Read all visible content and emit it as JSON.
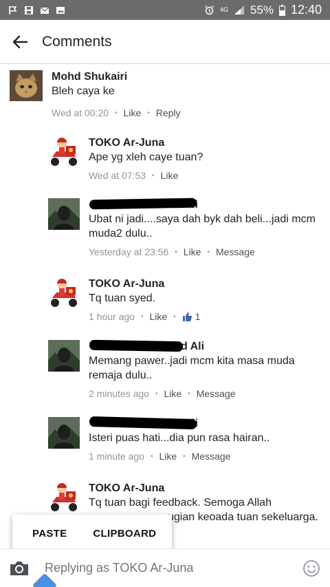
{
  "status_bar": {
    "battery": "55%",
    "time": "12:40",
    "network": "4G"
  },
  "header": {
    "title": "Comments"
  },
  "comments": [
    {
      "author": "Mohd Shukairi",
      "text": "Bleh caya ke",
      "time": "Wed at 00:20",
      "actions": [
        "Like",
        "Reply"
      ]
    },
    {
      "author": "TOKO Ar-Juna",
      "text": "Ape yg xleh caye tuan?",
      "time": "Wed at 07:53",
      "actions": [
        "Like"
      ]
    },
    {
      "author": "li",
      "text_lines": [
        "Ubat ni jadi....saya dah byk dah beli...jadi mcm",
        "muda2 dulu.."
      ],
      "time": "Yesterday at 23:56",
      "actions": [
        "Like",
        "Message"
      ]
    },
    {
      "author": "TOKO Ar-Juna",
      "text": "Tq tuan syed.",
      "time": "1 hour ago",
      "actions": [
        "Like"
      ],
      "like_count": "1"
    },
    {
      "author": "d Ali",
      "text_lines": [
        "Memang pawer..jadi mcm kita masa muda",
        "remaja dulu.."
      ],
      "time": "2 minutes ago",
      "actions": [
        "Like",
        "Message"
      ]
    },
    {
      "author": "li",
      "text": "Isteri puas hati...dia pun rasa hairan..",
      "time": "1 minute ago",
      "actions": [
        "Like",
        "Message"
      ]
    },
    {
      "author": "TOKO Ar-Juna",
      "text_lines": [
        "Tq tuan bagi feedback. Semoga Allah",
        "ugian keoada tuan sekeluarga."
      ]
    }
  ],
  "popup": {
    "paste": "PASTE",
    "clipboard": "CLIPBOARD"
  },
  "composer": {
    "placeholder": "Replying as TOKO Ar-Juna"
  },
  "colors": {
    "status_bar": "#6b6b6b",
    "link": "#4b4f56",
    "meta": "#90949c",
    "like_blue": "#4267b2",
    "handle": "#4a90e2"
  }
}
